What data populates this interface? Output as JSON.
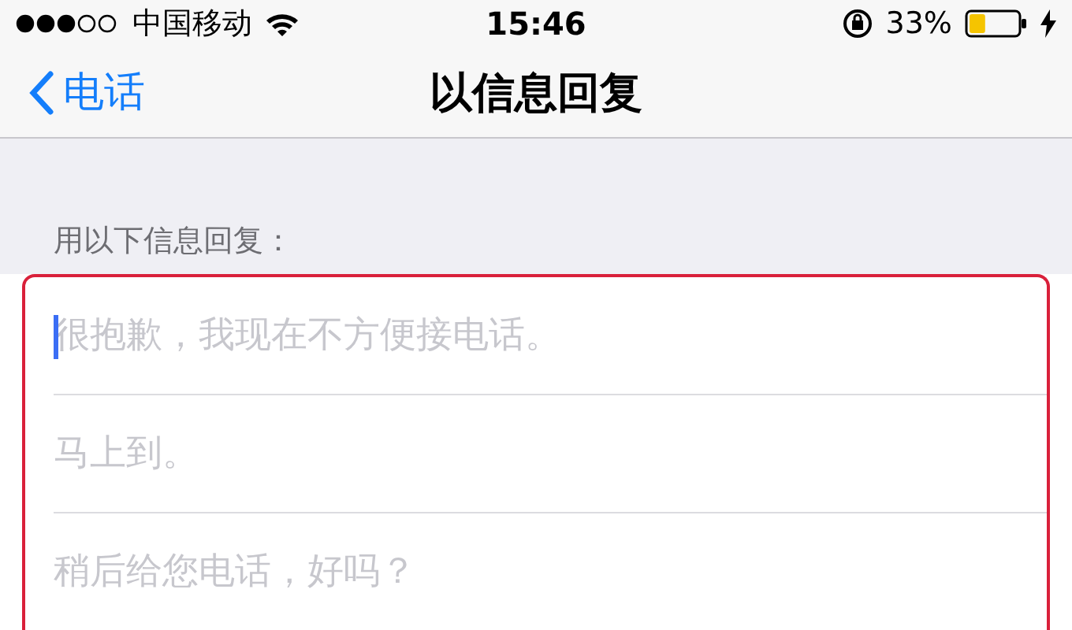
{
  "status_bar": {
    "carrier": "中国移动",
    "time": "15:46",
    "battery": "33%"
  },
  "nav": {
    "back": "电话",
    "title": "以信息回复"
  },
  "section_header": "用以下信息回复：",
  "replies": [
    {
      "placeholder": "很抱歉，我现在不方便接电话。",
      "focused": true
    },
    {
      "placeholder": "马上到。",
      "focused": false
    },
    {
      "placeholder": "稍后给您电话，好吗？",
      "focused": false
    }
  ]
}
